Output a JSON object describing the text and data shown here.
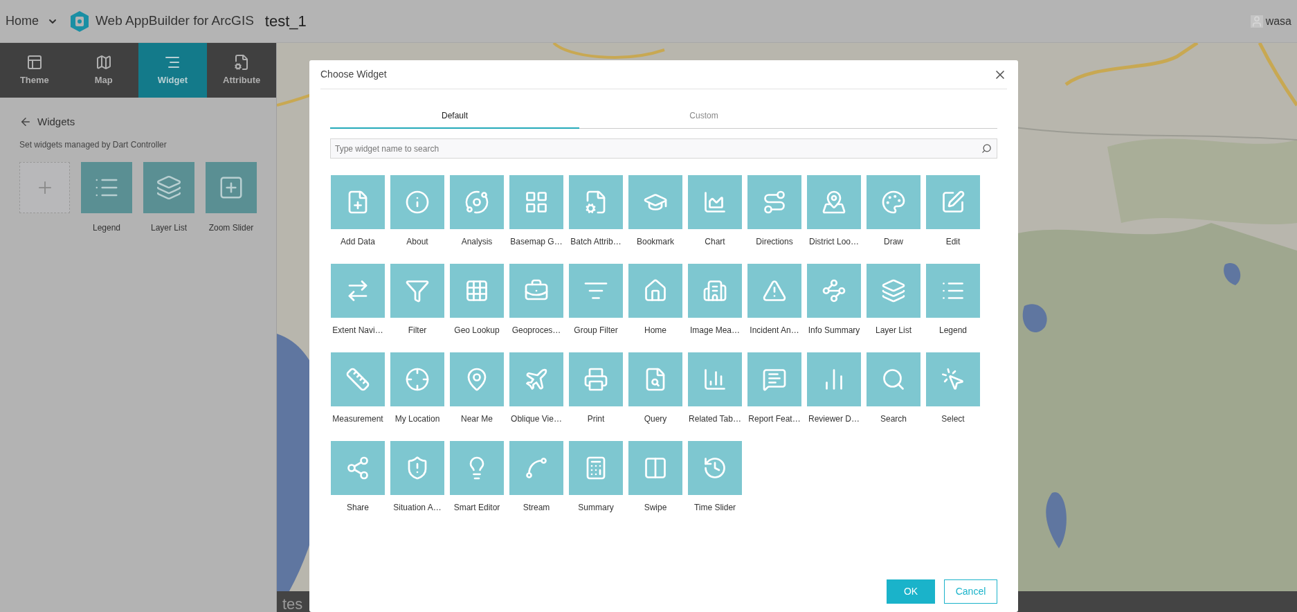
{
  "header": {
    "home": "Home",
    "product": "Web AppBuilder for ArcGIS",
    "app_title": "test_1",
    "user": "wasa"
  },
  "sidebar": {
    "tabs": [
      {
        "label": "Theme",
        "selected": false
      },
      {
        "label": "Map",
        "selected": false
      },
      {
        "label": "Widget",
        "selected": true
      },
      {
        "label": "Attribute",
        "selected": false
      }
    ],
    "back_title": "Widgets",
    "description": "Set widgets managed by Dart Controller",
    "widgets": [
      "Legend",
      "Layer List",
      "Zoom Slider"
    ]
  },
  "footer": {
    "text": "tes"
  },
  "dialog": {
    "title": "Choose Widget",
    "tabs": [
      {
        "label": "Default",
        "selected": true
      },
      {
        "label": "Custom",
        "selected": false
      }
    ],
    "search": {
      "placeholder": "Type widget name to search"
    },
    "widgets": [
      "Add Data",
      "About",
      "Analysis",
      "Basemap G…",
      "Batch Attrib…",
      "Bookmark",
      "Chart",
      "Directions",
      "District Loo…",
      "Draw",
      "Edit",
      "Extent Navi…",
      "Filter",
      "Geo Lookup",
      "Geoproces…",
      "Group Filter",
      "Home",
      "Image Mea…",
      "Incident An…",
      "Info Summary",
      "Layer List",
      "Legend",
      "Measurement",
      "My Location",
      "Near Me",
      "Oblique Vie…",
      "Print",
      "Query",
      "Related Tab…",
      "Report Feat…",
      "Reviewer D…",
      "Search",
      "Select",
      "Share",
      "Situation A…",
      "Smart Editor",
      "Stream",
      "Summary",
      "Swipe",
      "Time Slider"
    ],
    "buttons": {
      "ok": "OK",
      "cancel": "Cancel"
    }
  }
}
